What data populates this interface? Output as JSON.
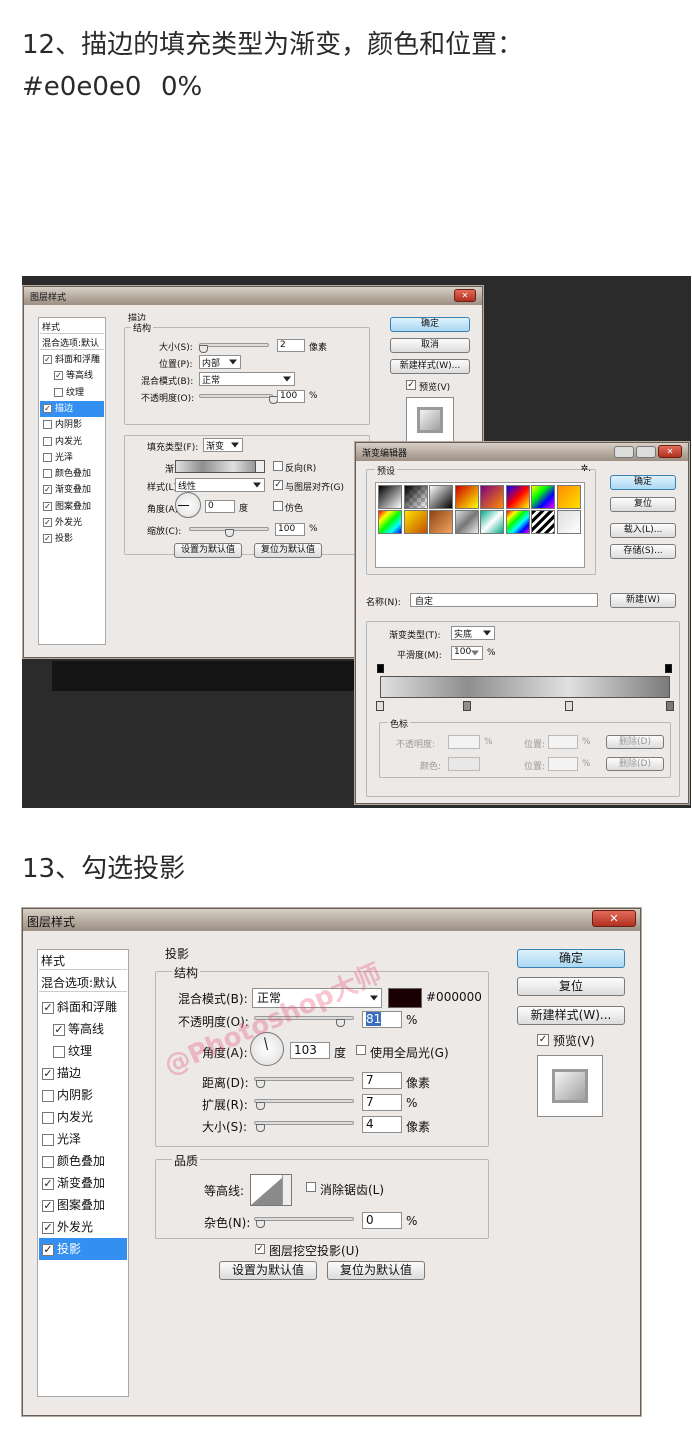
{
  "step12": {
    "heading": "12、描边的填充类型为渐变，颜色和位置：",
    "stops": [
      {
        "color": "#e0e0e0",
        "pos": "0%"
      },
      {
        "color": "#8e8e8e",
        "pos": "30%"
      },
      {
        "color": "#e0e0e0",
        "pos": "65%"
      },
      {
        "color": "#7a7a7a",
        "pos": "100%"
      }
    ]
  },
  "step13": {
    "heading": "13、勾选投影"
  },
  "shot1": {
    "layer_style": {
      "title": "图层样式",
      "close": "✕",
      "style_header": "样式",
      "blend_options": "混合选项:默认",
      "items": [
        {
          "label": "斜面和浮雕",
          "checked": true,
          "indent": false
        },
        {
          "label": "等高线",
          "checked": true,
          "indent": true
        },
        {
          "label": "纹理",
          "checked": false,
          "indent": true
        },
        {
          "label": "描边",
          "checked": true,
          "indent": false,
          "selected": true
        },
        {
          "label": "内阴影",
          "checked": false,
          "indent": false
        },
        {
          "label": "内发光",
          "checked": false,
          "indent": false
        },
        {
          "label": "光泽",
          "checked": false,
          "indent": false
        },
        {
          "label": "颜色叠加",
          "checked": false,
          "indent": false
        },
        {
          "label": "渐变叠加",
          "checked": true,
          "indent": false
        },
        {
          "label": "图案叠加",
          "checked": true,
          "indent": false
        },
        {
          "label": "外发光",
          "checked": true,
          "indent": false
        },
        {
          "label": "投影",
          "checked": true,
          "indent": false
        }
      ],
      "section": "描边",
      "struct": "结构",
      "size_label": "大小(S):",
      "size_value": "2",
      "size_unit": "像素",
      "position_label": "位置(P):",
      "position_value": "内部",
      "blend_label": "混合模式(B):",
      "blend_value": "正常",
      "opacity_label": "不透明度(O):",
      "opacity_value": "100",
      "opacity_unit": "%",
      "fill_type_label": "填充类型(F):",
      "fill_type_value": "渐变",
      "gradient_label": "渐变:",
      "reverse_label": "反向(R)",
      "style_label": "样式(L):",
      "style_value": "线性",
      "align_label": "与图层对齐(G)",
      "angle_label": "角度(A):",
      "angle_value": "0",
      "angle_unit": "度",
      "dither_label": "仿色",
      "scale_label": "缩放(C):",
      "scale_value": "100",
      "scale_unit": "%",
      "set_default": "设置为默认值",
      "reset_default": "复位为默认值",
      "ok": "确定",
      "cancel": "取消",
      "new_style": "新建样式(W)...",
      "preview": "预览(V)"
    },
    "gradient_editor": {
      "title": "渐变编辑器",
      "presets_label": "预设",
      "gear": "✲.",
      "ok": "确定",
      "reset": "复位",
      "load": "载入(L)...",
      "save": "存储(S)...",
      "name_label": "名称(N):",
      "name_value": "自定",
      "new_btn": "新建(W)",
      "type_label": "渐变类型(T):",
      "type_value": "实底",
      "smooth_label": "平滑度(M):",
      "smooth_value": "100",
      "smooth_unit": "%",
      "stops_group": "色标",
      "opacity_label": "不透明度:",
      "pct": "%",
      "position_label": "位置:",
      "color_label": "颜色:",
      "delete_btn": "删除(D)"
    }
  },
  "shot2": {
    "layer_style": {
      "title": "图层样式",
      "close": "✕",
      "style_header": "样式",
      "blend_options": "混合选项:默认",
      "items": [
        {
          "label": "斜面和浮雕",
          "checked": true,
          "indent": false
        },
        {
          "label": "等高线",
          "checked": true,
          "indent": true
        },
        {
          "label": "纹理",
          "checked": false,
          "indent": true
        },
        {
          "label": "描边",
          "checked": true,
          "indent": false
        },
        {
          "label": "内阴影",
          "checked": false,
          "indent": false
        },
        {
          "label": "内发光",
          "checked": false,
          "indent": false
        },
        {
          "label": "光泽",
          "checked": false,
          "indent": false
        },
        {
          "label": "颜色叠加",
          "checked": false,
          "indent": false
        },
        {
          "label": "渐变叠加",
          "checked": true,
          "indent": false
        },
        {
          "label": "图案叠加",
          "checked": true,
          "indent": false
        },
        {
          "label": "外发光",
          "checked": true,
          "indent": false
        },
        {
          "label": "投影",
          "checked": true,
          "indent": false,
          "selected": true
        }
      ],
      "section": "投影",
      "struct": "结构",
      "blend_label": "混合模式(B):",
      "blend_value": "正常",
      "shadow_color": "#000000",
      "shadow_hex": "#000000",
      "opacity_label": "不透明度(O):",
      "opacity_value": "81",
      "opacity_unit": "%",
      "angle_label": "角度(A):",
      "angle_value": "103",
      "angle_unit": "度",
      "global_light": "使用全局光(G)",
      "distance_label": "距离(D):",
      "distance_value": "7",
      "distance_unit": "像素",
      "spread_label": "扩展(R):",
      "spread_value": "7",
      "spread_unit": "%",
      "size_label": "大小(S):",
      "size_value": "4",
      "size_unit": "像素",
      "quality": "品质",
      "contour_label": "等高线:",
      "antialias": "消除锯齿(L)",
      "noise_label": "杂色(N):",
      "noise_value": "0",
      "noise_unit": "%",
      "knockout": "图层挖空投影(U)",
      "set_default": "设置为默认值",
      "reset_default": "复位为默认值",
      "ok": "确定",
      "reset": "复位",
      "new_style": "新建样式(W)...",
      "preview": "预览(V)",
      "watermark": "@Photoshop大师"
    }
  }
}
